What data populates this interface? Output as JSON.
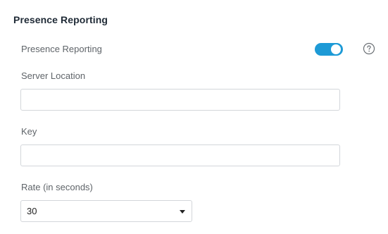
{
  "section": {
    "title": "Presence Reporting"
  },
  "presence": {
    "label": "Presence Reporting",
    "enabled": true,
    "help_icon": "question-circle-icon"
  },
  "server_location": {
    "label": "Server Location",
    "value": "",
    "placeholder": ""
  },
  "key": {
    "label": "Key",
    "value": "",
    "placeholder": ""
  },
  "rate": {
    "label": "Rate (in seconds)",
    "selected": "30"
  },
  "colors": {
    "toggle_on": "#1d9ad6",
    "title": "#1f2a36",
    "label": "#5f6469",
    "input_border": "#d3d6da"
  }
}
